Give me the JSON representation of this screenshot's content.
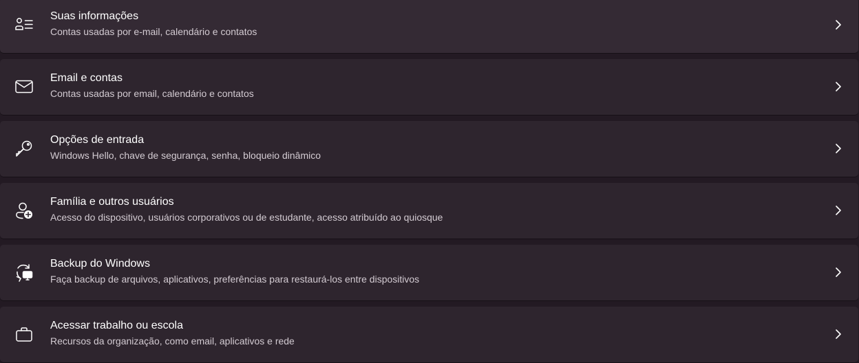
{
  "settings_list": {
    "items": [
      {
        "title": "Suas informações",
        "description": "Contas usadas por e-mail, calendário e contatos",
        "icon": "person-list-icon"
      },
      {
        "title": "Email e contas",
        "description": "Contas usadas por email, calendário e contatos",
        "icon": "mail-icon"
      },
      {
        "title": "Opções de entrada",
        "description": "Windows Hello, chave de segurança, senha, bloqueio dinâmico",
        "icon": "key-icon"
      },
      {
        "title": "Família e outros usuários",
        "description": "Acesso do dispositivo, usuários corporativos ou de estudante, acesso atribuído ao quiosque",
        "icon": "person-add-icon"
      },
      {
        "title": "Backup do Windows",
        "description": "Faça backup de arquivos, aplicativos, preferências para restaurá-los entre dispositivos",
        "icon": "backup-sync-icon"
      },
      {
        "title": "Acessar trabalho ou escola",
        "description": "Recursos da organização, como email, aplicativos e rede",
        "icon": "briefcase-icon"
      }
    ]
  },
  "colors": {
    "background": "#231a23",
    "card": "#2e252e",
    "title_text": "#ffffff",
    "description_text": "#d3cbd2"
  }
}
